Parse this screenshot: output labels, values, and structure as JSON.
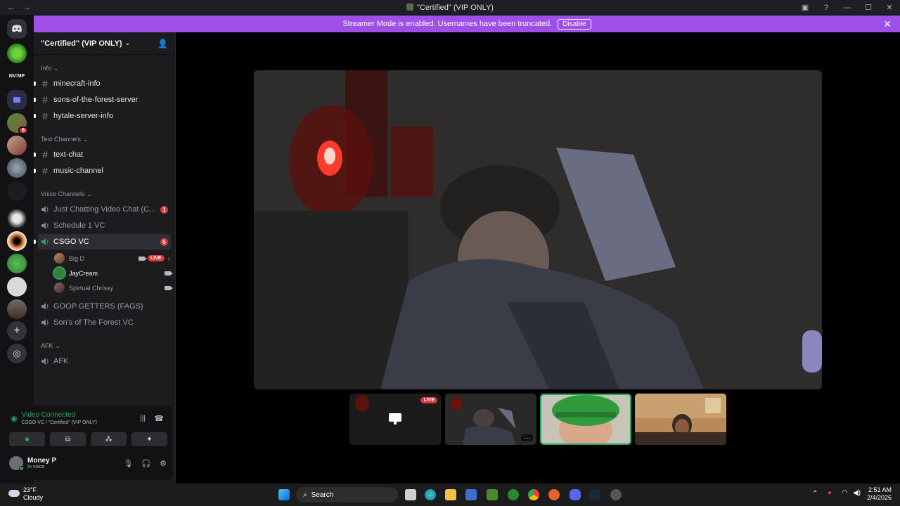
{
  "window": {
    "title": "\"Certified\" (VIP ONLY)"
  },
  "banner": {
    "text": "Streamer Mode is enabled. Usernames have been truncated.",
    "button": "Disable"
  },
  "servers": {
    "nvmp_label": "NV:MP",
    "badge_count": "6"
  },
  "guild": {
    "name": "\"Certified\" (VIP ONLY)"
  },
  "categories": {
    "info": "Info",
    "text": "Text Channels",
    "voice": "Voice Channels",
    "afk": "AFK"
  },
  "info_channels": [
    "minecraft-info",
    "sons-of-the-forest-server",
    "hytale-server-info"
  ],
  "text_channels": [
    "text-chat",
    "music-channel"
  ],
  "voice_channels": {
    "just_chatting": {
      "name": "Just Chatting Video Chat (C...",
      "badge": "1"
    },
    "schedule": {
      "name": "Schedule 1 VC"
    },
    "csgo": {
      "name": "CSGO VC",
      "badge": "5"
    },
    "goop": {
      "name": "GOOP GETTERS (FAGS)"
    },
    "sons": {
      "name": "Son's of The Forest VC"
    },
    "afk": {
      "name": "AFK"
    }
  },
  "csgo_users": [
    {
      "name": "Big D",
      "live": "LIVE"
    },
    {
      "name": "JayCream"
    },
    {
      "name": "Spirtual Chrissy"
    }
  ],
  "voice_panel": {
    "status": "Video Connected",
    "location": "CSGO VC / \"Certified\" (VIP ONLY)"
  },
  "user": {
    "name": "Money P",
    "status": "In voice"
  },
  "stage": {
    "thumb_live": "LIVE"
  },
  "taskbar": {
    "temp": "23°F",
    "condition": "Cloudy",
    "search": "Search",
    "time": "2:51 AM",
    "date": "2/4/2026"
  },
  "colors": {
    "accent": "#9d4fe8",
    "green": "#23a55a",
    "red": "#da373c"
  }
}
